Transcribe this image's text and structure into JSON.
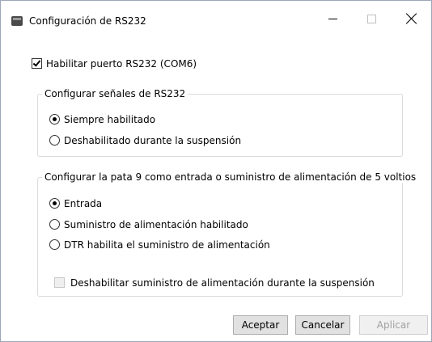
{
  "window": {
    "title": "Configuración de RS232",
    "minimize_icon": "minimize-icon",
    "maximize_icon": "maximize-icon",
    "close_icon": "close-icon"
  },
  "enable_port": {
    "label": "Habilitar puerto RS232 (COM6)",
    "checked": true
  },
  "signals_group": {
    "legend": "Configurar señales de RS232",
    "options": [
      {
        "label": "Siempre habilitado",
        "selected": true
      },
      {
        "label": "Deshabilitado durante la suspensión",
        "selected": false
      }
    ]
  },
  "pin9_group": {
    "legend": "Configurar la pata 9 como entrada o suministro de alimentación de 5 voltios",
    "options": [
      {
        "label": "Entrada",
        "selected": true
      },
      {
        "label": "Suministro de alimentación habilitado",
        "selected": false
      },
      {
        "label": "DTR habilita el suministro de alimentación",
        "selected": false
      }
    ],
    "disable_on_suspend": {
      "label": "Deshabilitar suministro de alimentación durante la suspensión",
      "checked": false,
      "enabled": false
    }
  },
  "buttons": {
    "accept": "Aceptar",
    "cancel": "Cancelar",
    "apply": "Aplicar"
  }
}
